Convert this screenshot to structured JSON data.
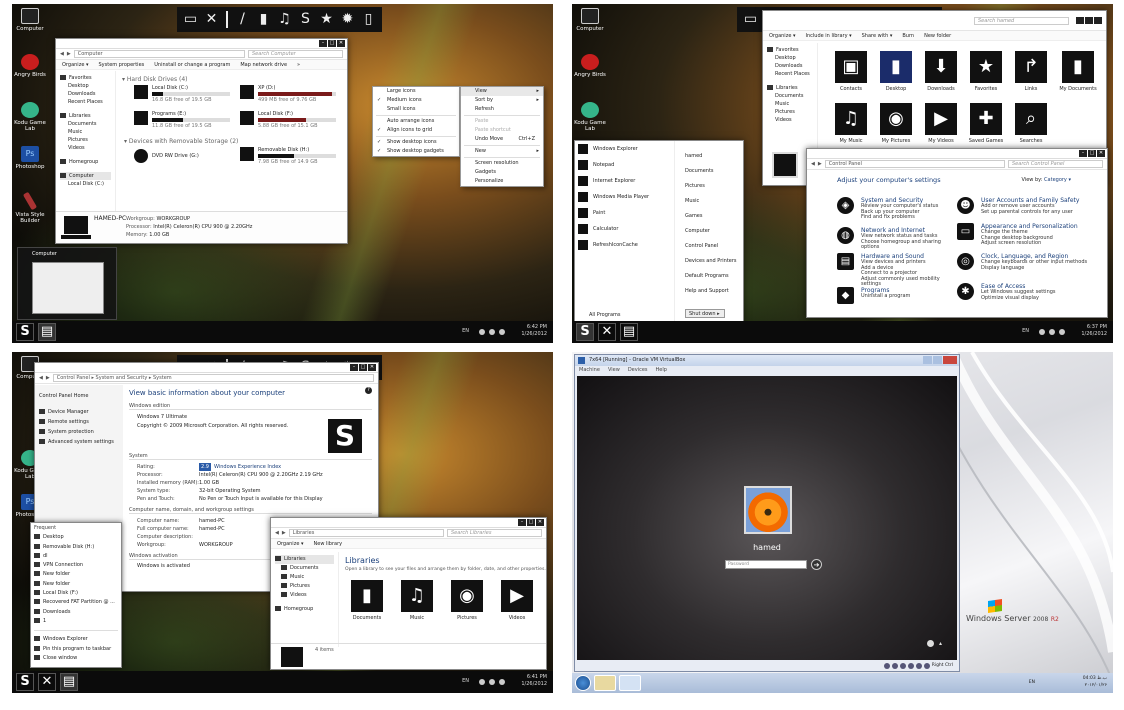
{
  "topbar_icons": [
    "computer-icon",
    "tools-icon",
    "brush-icon",
    "document-icon",
    "music-icon",
    "s-logo-icon",
    "star-icon",
    "gear-icon",
    "trash-icon"
  ],
  "desktop_icons": {
    "computer": "Computer",
    "angry_birds": "Angry Birds",
    "kodu": "Kodu Game Lab",
    "photoshop": "Photoshop",
    "vista_builder": "Vista Style Builder"
  },
  "q1": {
    "addr": "Computer",
    "search": "Search Computer",
    "cmd": [
      "Organize ▾",
      "System properties",
      "Uninstall or change a program",
      "Map network drive",
      "»"
    ],
    "nav": {
      "favorites": "Favorites",
      "items": [
        "Desktop",
        "Downloads",
        "Recent Places"
      ],
      "libraries": "Libraries",
      "lib_items": [
        "Documents",
        "Music",
        "Pictures",
        "Videos"
      ],
      "homegroup": "Homegroup",
      "computer": "Computer",
      "comp_items": [
        "Local Disk (C:)"
      ]
    },
    "hdd_header": "Hard Disk Drives (4)",
    "drives": [
      {
        "name": "Local Disk (C:)",
        "free": "16.8 GB free of 19.5 GB",
        "fill": 0.14
      },
      {
        "name": "XP (D:)",
        "free": "499 MB free of 9.76 GB",
        "fill": 0.95
      },
      {
        "name": "Programs (E:)",
        "free": "11.8 GB free of 19.5 GB",
        "fill": 0.4
      },
      {
        "name": "Local Disk (F:)",
        "free": "5.88 GB free of 15.1 GB",
        "fill": 0.61
      }
    ],
    "removable_header": "Devices with Removable Storage (2)",
    "removable": [
      {
        "name": "DVD RW Drive (G:)"
      },
      {
        "name": "Removable Disk (H:)",
        "free": "7.98 GB free of 14.9 GB",
        "fill": 0.46
      }
    ],
    "details": {
      "pc": "HAMED-PC",
      "wg_k": "Workgroup:",
      "wg": "WORKGROUP",
      "proc_k": "Processor:",
      "proc": "Intel(R) Celeron(R) CPU        900 @ 2.20GHz",
      "mem_k": "Memory:",
      "mem": "1.00 GB"
    },
    "ctx1": [
      "Large icons",
      "Medium icons",
      "Small icons",
      "Auto arrange icons",
      "Align icons to grid",
      "Show desktop icons",
      "Show desktop gadgets"
    ],
    "ctx2": [
      "View",
      "Sort by",
      "Refresh",
      "Paste",
      "Paste shortcut",
      "Undo Move",
      "Ctrl+Z",
      "New",
      "Screen resolution",
      "Gadgets",
      "Personalize"
    ],
    "thumb": "Computer",
    "tray": {
      "lang": "EN",
      "time": "6:42 PM",
      "date": "1/26/2012"
    }
  },
  "q2": {
    "search": "Search hamed",
    "cmd": [
      "Organize ▾",
      "Include in library ▾",
      "Share with ▾",
      "Burn",
      "New folder"
    ],
    "nav": {
      "favorites": "Favorites",
      "items": [
        "Desktop",
        "Downloads",
        "Recent Places"
      ],
      "libraries": "Libraries",
      "lib_items": [
        "Documents",
        "Music",
        "Pictures",
        "Videos"
      ]
    },
    "folders": [
      "Contacts",
      "Desktop",
      "Downloads",
      "Favorites",
      "Links",
      "My Documents",
      "My Music",
      "My Pictures",
      "My Videos",
      "Saved Games",
      "Searches"
    ],
    "start_left": [
      "Windows Explorer",
      "Notepad",
      "Internet Explorer",
      "Windows Media Player",
      "Paint",
      "Calculator",
      "RefreshIconCache"
    ],
    "start_right": [
      "hamed",
      "Documents",
      "Pictures",
      "Music",
      "Games",
      "Computer",
      "Control Panel",
      "Devices and Printers",
      "Default Programs",
      "Help and Support"
    ],
    "all_programs": "All Programs",
    "shutdown": "Shut down",
    "cp": {
      "addr": "Control Panel",
      "search": "Search Control Panel",
      "heading": "Adjust your computer's settings",
      "viewby": "View by:",
      "category": "Category ▾",
      "items": [
        {
          "h": "System and Security",
          "s": [
            "Review your computer's status",
            "Back up your computer",
            "Find and fix problems"
          ]
        },
        {
          "h": "User Accounts and Family Safety",
          "s": [
            "Add or remove user accounts",
            "Set up parental controls for any user"
          ]
        },
        {
          "h": "Network and Internet",
          "s": [
            "View network status and tasks",
            "Choose homegroup and sharing options"
          ]
        },
        {
          "h": "Appearance and Personalization",
          "s": [
            "Change the theme",
            "Change desktop background",
            "Adjust screen resolution"
          ]
        },
        {
          "h": "Hardware and Sound",
          "s": [
            "View devices and printers",
            "Add a device",
            "Connect to a projector",
            "Adjust commonly used mobility settings"
          ]
        },
        {
          "h": "Clock, Language, and Region",
          "s": [
            "Change keyboards or other input methods",
            "Display language"
          ]
        },
        {
          "h": "Programs",
          "s": [
            "Uninstall a program"
          ]
        },
        {
          "h": "Ease of Access",
          "s": [
            "Let Windows suggest settings",
            "Optimize visual display"
          ]
        }
      ]
    },
    "tray": {
      "lang": "EN",
      "time": "6:37 PM",
      "date": "1/26/2012"
    }
  },
  "q3": {
    "addr": "Control Panel  ▸  System and Security  ▸  System",
    "side": {
      "home": "Control Panel Home",
      "links": [
        "Device Manager",
        "Remote settings",
        "System protection",
        "Advanced system settings"
      ]
    },
    "title": "View basic information about your computer",
    "edition_h": "Windows edition",
    "edition": "Windows 7 Ultimate",
    "copyright": "Copyright © 2009 Microsoft Corporation.  All rights reserved.",
    "system_h": "System",
    "sys": [
      [
        "Rating:",
        "Windows Experience Index"
      ],
      [
        "Processor:",
        "Intel(R) Celeron(R) CPU      900 @ 2.20GHz   2.19 GHz"
      ],
      [
        "Installed memory (RAM):",
        "1.00 GB"
      ],
      [
        "System type:",
        "32-bit Operating System"
      ],
      [
        "Pen and Touch:",
        "No Pen or Touch Input is available for this Display"
      ]
    ],
    "rating": "2.9",
    "cn_h": "Computer name, domain, and workgroup settings",
    "cn": [
      [
        "Computer name:",
        "hamed-PC"
      ],
      [
        "Full computer name:",
        "hamed-PC"
      ],
      [
        "Computer description:",
        ""
      ],
      [
        "Workgroup:",
        "WORKGROUP"
      ]
    ],
    "act_h": "Windows activation",
    "act": "Windows is activated",
    "jump": {
      "title": "Frequent",
      "items": [
        "Desktop",
        "Removable Disk (H:)",
        "dl",
        "VPN Connection",
        "New folder",
        "New folder",
        "Local Disk (F:)",
        "Recovered FAT Partition @ ...",
        "Downloads",
        "1"
      ],
      "app": "Windows Explorer",
      "pin": "Pin this program to taskbar",
      "close": "Close window"
    },
    "lib": {
      "addr": "Libraries",
      "search": "Search Libraries",
      "cmd": [
        "Organize ▾",
        "New library"
      ],
      "nav": [
        "Libraries",
        "Documents",
        "Music",
        "Pictures",
        "Videos",
        "Homegroup"
      ],
      "title": "Libraries",
      "sub": "Open a library to see your files and arrange them by folder, date, and other properties.",
      "tiles": [
        "Documents",
        "Music",
        "Pictures",
        "Videos"
      ],
      "count": "4 items"
    },
    "tray": {
      "lang": "EN",
      "time": "6:41 PM",
      "date": "1/26/2012"
    }
  },
  "q4": {
    "vb_title": "7x64 [Running] - Oracle VM VirtualBox",
    "vb_menu": [
      "Machine",
      "View",
      "Devices",
      "Help"
    ],
    "user": "hamed",
    "password": "Password",
    "host_key": "Right Ctrl",
    "server_brand": "Windows Server",
    "server_ver": "2008",
    "server_r2": "R2",
    "tray": {
      "lang": "EN",
      "time": "04:03 ب.ظ",
      "date": "۲۰۱۲/۰۱/۲۶"
    }
  }
}
